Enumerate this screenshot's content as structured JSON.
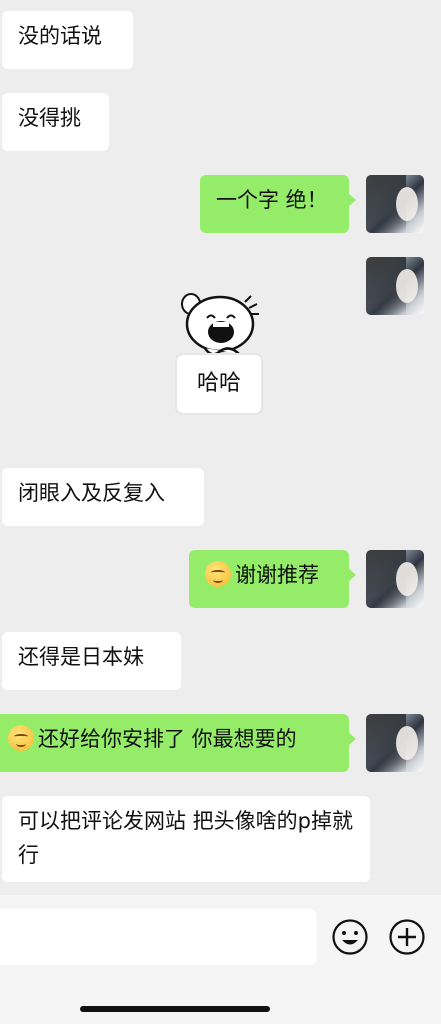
{
  "messages": [
    {
      "side": "in",
      "text": "没的话说"
    },
    {
      "side": "in",
      "text": "没得挑"
    },
    {
      "side": "out",
      "text": "一个字 绝！"
    },
    {
      "side": "in",
      "sticker": "哈哈"
    },
    {
      "side": "in",
      "text": "闭眼入及反复入"
    },
    {
      "side": "out",
      "emoji": "thinking-face",
      "text": "谢谢推荐"
    },
    {
      "side": "in",
      "text": "还得是日本妹"
    },
    {
      "side": "out",
      "emoji": "thinking-face",
      "text": "还好给你安排了 你最想要的"
    },
    {
      "side": "in",
      "text": "可以把评论发网站 把头像啥的p掉就行"
    }
  ],
  "input_bar": {
    "placeholder": "",
    "value": "",
    "icons": [
      "emoji-icon",
      "plus-icon"
    ]
  },
  "colors": {
    "background": "#ededed",
    "incoming_bubble": "#ffffff",
    "outgoing_bubble": "#95ec69"
  }
}
